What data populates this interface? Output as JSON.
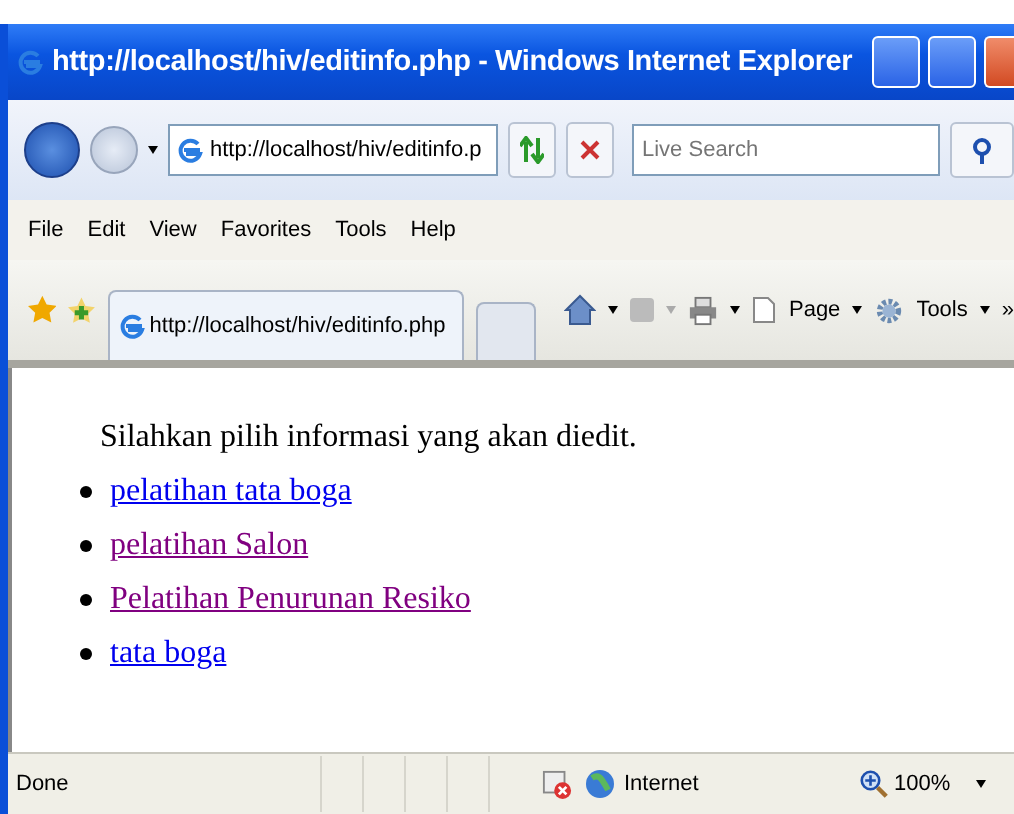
{
  "window": {
    "title": "http://localhost/hiv/editinfo.php - Windows Internet Explorer"
  },
  "address_bar": {
    "value": "http://localhost/hiv/editinfo.p"
  },
  "search": {
    "placeholder": "Live Search"
  },
  "menu": [
    "File",
    "Edit",
    "View",
    "Favorites",
    "Tools",
    "Help"
  ],
  "tabs": [
    {
      "label": "http://localhost/hiv/editinfo.php",
      "selected": true
    }
  ],
  "command_bar": {
    "page": "Page",
    "tools": "Tools",
    "more": "»"
  },
  "content": {
    "intro": "Silahkan pilih informasi yang akan diedit.",
    "links": [
      {
        "label": "pelatihan tata boga",
        "visited": false
      },
      {
        "label": "pelatihan Salon",
        "visited": true
      },
      {
        "label": "Pelatihan Penurunan Resiko",
        "visited": true
      },
      {
        "label": "tata boga",
        "visited": false
      }
    ]
  },
  "status_bar": {
    "status": "Done",
    "zone": "Internet",
    "zoom": "100%"
  }
}
